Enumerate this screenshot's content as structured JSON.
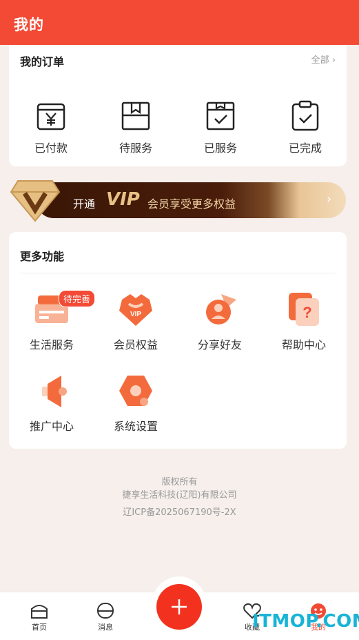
{
  "header": {
    "title": "我的"
  },
  "orders": {
    "title": "我的订单",
    "all_link": "全部 ›",
    "items": [
      {
        "label": "已付款",
        "icon": "yen-wallet-icon"
      },
      {
        "label": "待服务",
        "icon": "package-icon"
      },
      {
        "label": "已服务",
        "icon": "checked-box-icon"
      },
      {
        "label": "已完成",
        "icon": "clipboard-check-icon"
      }
    ]
  },
  "vip": {
    "open": "开通",
    "big": "VIP",
    "desc": "会员享受更多权益",
    "arrow": "›"
  },
  "more": {
    "title": "更多功能",
    "items": [
      {
        "label": "生活服务",
        "icon": "truck-icon",
        "badge": "待完善"
      },
      {
        "label": "会员权益",
        "icon": "vip-shield-icon"
      },
      {
        "label": "分享好友",
        "icon": "share-user-icon"
      },
      {
        "label": "帮助中心",
        "icon": "help-question-icon"
      },
      {
        "label": "推广中心",
        "icon": "megaphone-icon"
      },
      {
        "label": "系统设置",
        "icon": "settings-hex-icon"
      }
    ]
  },
  "footer": {
    "line1": "版权所有",
    "line2": "捷享生活科技(辽阳)有限公司",
    "line3": "辽ICP备2025067190号-2X"
  },
  "tabbar": {
    "items": [
      {
        "label": "首页",
        "icon": "home-icon"
      },
      {
        "label": "消息",
        "icon": "message-icon"
      },
      {
        "label": "收藏",
        "icon": "heart-icon"
      },
      {
        "label": "我的",
        "icon": "smile-icon"
      }
    ],
    "fab_icon": "plus-icon"
  },
  "watermark": "ITMOP.COM",
  "colors": {
    "brand": "#f24a35",
    "accent_orange": "#f36b3c",
    "vip_dark": "#3a1606",
    "vip_gold": "#e7c185"
  }
}
